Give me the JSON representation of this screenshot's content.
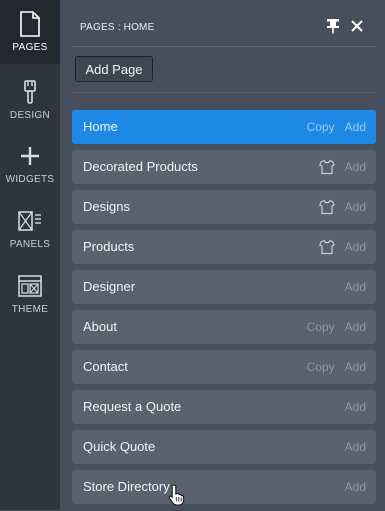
{
  "rail": {
    "items": [
      {
        "label": "PAGES",
        "icon": "page-icon",
        "active": true
      },
      {
        "label": "DESIGN",
        "icon": "brush-icon",
        "active": false
      },
      {
        "label": "WIDGETS",
        "icon": "plus-icon",
        "active": false
      },
      {
        "label": "PANELS",
        "icon": "panel-icon",
        "active": false
      },
      {
        "label": "THEME",
        "icon": "theme-icon",
        "active": false
      }
    ]
  },
  "header": {
    "breadcrumb": "PAGES : HOME",
    "pin_icon": "pin-icon",
    "close_icon": "close-icon"
  },
  "toolbar": {
    "add_page_label": "Add Page"
  },
  "pages": [
    {
      "label": "Home",
      "copy": "Copy",
      "add": "Add",
      "active": true,
      "shirt": false
    },
    {
      "label": "Decorated Products",
      "copy": "",
      "add": "Add",
      "active": false,
      "shirt": true
    },
    {
      "label": "Designs",
      "copy": "",
      "add": "Add",
      "active": false,
      "shirt": true
    },
    {
      "label": "Products",
      "copy": "",
      "add": "Add",
      "active": false,
      "shirt": true
    },
    {
      "label": "Designer",
      "copy": "",
      "add": "Add",
      "active": false,
      "shirt": false
    },
    {
      "label": "About",
      "copy": "Copy",
      "add": "Add",
      "active": false,
      "shirt": false
    },
    {
      "label": "Contact",
      "copy": "Copy",
      "add": "Add",
      "active": false,
      "shirt": false
    },
    {
      "label": "Request a Quote",
      "copy": "",
      "add": "Add",
      "active": false,
      "shirt": false
    },
    {
      "label": "Quick Quote",
      "copy": "",
      "add": "Add",
      "active": false,
      "shirt": false
    },
    {
      "label": "Store Directory",
      "copy": "",
      "add": "Add",
      "active": false,
      "shirt": false
    }
  ],
  "colors": {
    "accent": "#1e88e5",
    "rail_bg": "#2f353e",
    "panel_bg": "#474f5c",
    "row_bg": "#5a6270"
  }
}
